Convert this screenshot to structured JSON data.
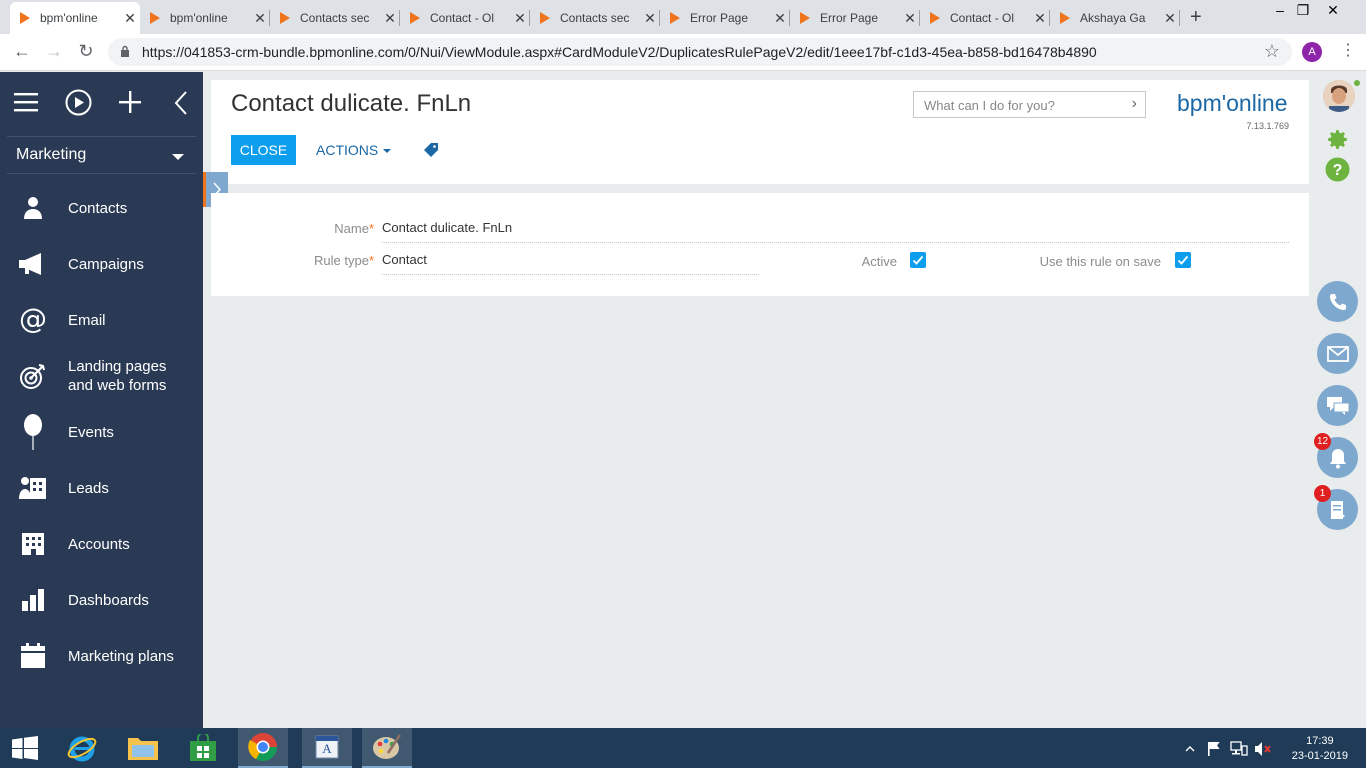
{
  "browser": {
    "tabs": [
      {
        "title": "bpm'online",
        "active": true
      },
      {
        "title": "bpm'online",
        "active": false
      },
      {
        "title": "Contacts sec",
        "active": false
      },
      {
        "title": "Contact - Ol",
        "active": false
      },
      {
        "title": "Contacts sec",
        "active": false
      },
      {
        "title": "Error Page",
        "active": false
      },
      {
        "title": "Error Page",
        "active": false
      },
      {
        "title": "Contact - Ol",
        "active": false
      },
      {
        "title": "Akshaya Ga",
        "active": false
      }
    ],
    "url": "https://041853-crm-bundle.bpmonline.com/0/Nui/ViewModule.aspx#CardModuleV2/DuplicatesRulePageV2/edit/1eee17bf-c1d3-45ea-b858-bd16478b4890",
    "profile_initial": "A"
  },
  "sidebar": {
    "workplace": "Marketing",
    "items": [
      {
        "label": "Contacts",
        "icon": "person-icon"
      },
      {
        "label": "Campaigns",
        "icon": "megaphone-icon"
      },
      {
        "label": "Email",
        "icon": "at-sign-icon"
      },
      {
        "label": "Landing pages\nand web forms",
        "icon": "target-icon"
      },
      {
        "label": "Events",
        "icon": "balloon-icon"
      },
      {
        "label": "Leads",
        "icon": "leads-icon"
      },
      {
        "label": "Accounts",
        "icon": "building-icon"
      },
      {
        "label": "Dashboards",
        "icon": "bar-chart-icon"
      },
      {
        "label": "Marketing plans",
        "icon": "calendar-icon"
      }
    ]
  },
  "header": {
    "title": "Contact dulicate. FnLn",
    "search_placeholder": "What can I do for you?",
    "logo": "bpm'online",
    "version": "7.13.1.769",
    "close_label": "CLOSE",
    "actions_label": "ACTIONS"
  },
  "form": {
    "name_label": "Name",
    "name_value": "Contact dulicate. FnLn",
    "rule_type_label": "Rule type",
    "rule_type_value": "Contact",
    "active_label": "Active",
    "active_checked": true,
    "use_on_save_label": "Use this rule on save",
    "use_on_save_checked": true
  },
  "right_panel": {
    "notifications_count": "12",
    "tasks_count": "1"
  },
  "taskbar": {
    "time": "17:39",
    "date": "23-01-2019"
  },
  "colors": {
    "accent": "#0d9eee",
    "sidebar": "#2b3a54",
    "brand_orange": "#f0731e",
    "brand_blue": "#1b68a5"
  }
}
